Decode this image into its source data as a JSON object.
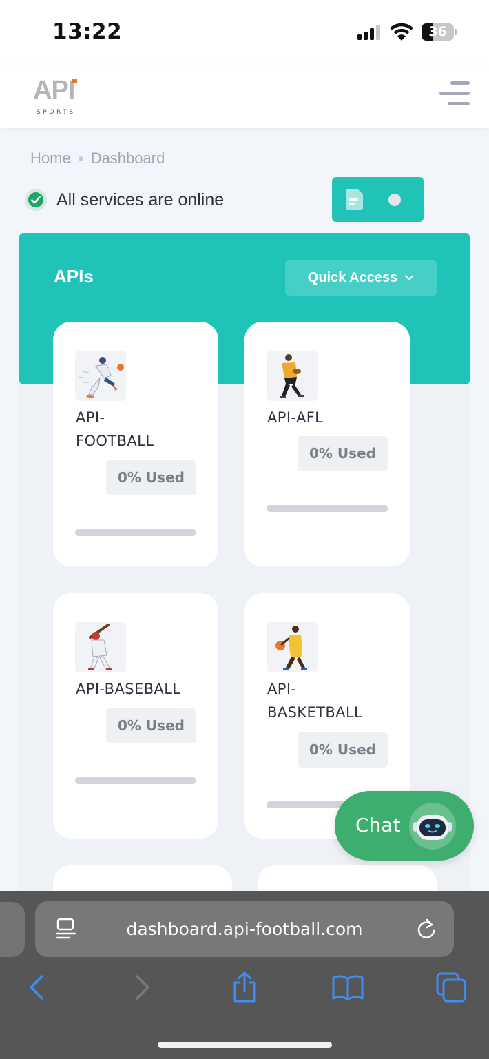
{
  "status_bar": {
    "time": "13:22",
    "battery": "36",
    "signal_icon": "cellular-signal-icon",
    "wifi_icon": "wifi-icon"
  },
  "header": {
    "logo_main": "API",
    "logo_sub": "SPORTS",
    "menu_icon": "hamburger-menu-icon"
  },
  "breadcrumb": [
    "Home",
    "Dashboard"
  ],
  "service_status": {
    "text": "All services are online",
    "icon": "check-circle-icon",
    "color": "#20a466"
  },
  "theme_toggle": {
    "icon": "document-icon"
  },
  "apis": {
    "title": "APIs",
    "quick_access_label": "Quick Access",
    "accent": "#1fc3b8",
    "cards": [
      {
        "name": "API-\nFOOTBALL",
        "usage": "0% Used",
        "usage_fraction": 0,
        "icon": "football-player-icon"
      },
      {
        "name": "API-AFL",
        "usage": "0% Used",
        "usage_fraction": 0,
        "icon": "afl-player-icon"
      },
      {
        "name": "API-BASEBALL",
        "usage": "0% Used",
        "usage_fraction": 0,
        "icon": "baseball-player-icon"
      },
      {
        "name": "API-\nBASKETBALL",
        "usage": "0% Used",
        "usage_fraction": 0,
        "icon": "basketball-player-icon"
      }
    ]
  },
  "chat": {
    "label": "Chat",
    "icon": "robot-icon",
    "color": "#3dae6f"
  },
  "browser": {
    "url": "dashboard.api-football.com",
    "icons": [
      "reader-icon",
      "reload-icon",
      "back-icon",
      "forward-icon",
      "share-icon",
      "bookmarks-icon",
      "tabs-icon"
    ]
  }
}
